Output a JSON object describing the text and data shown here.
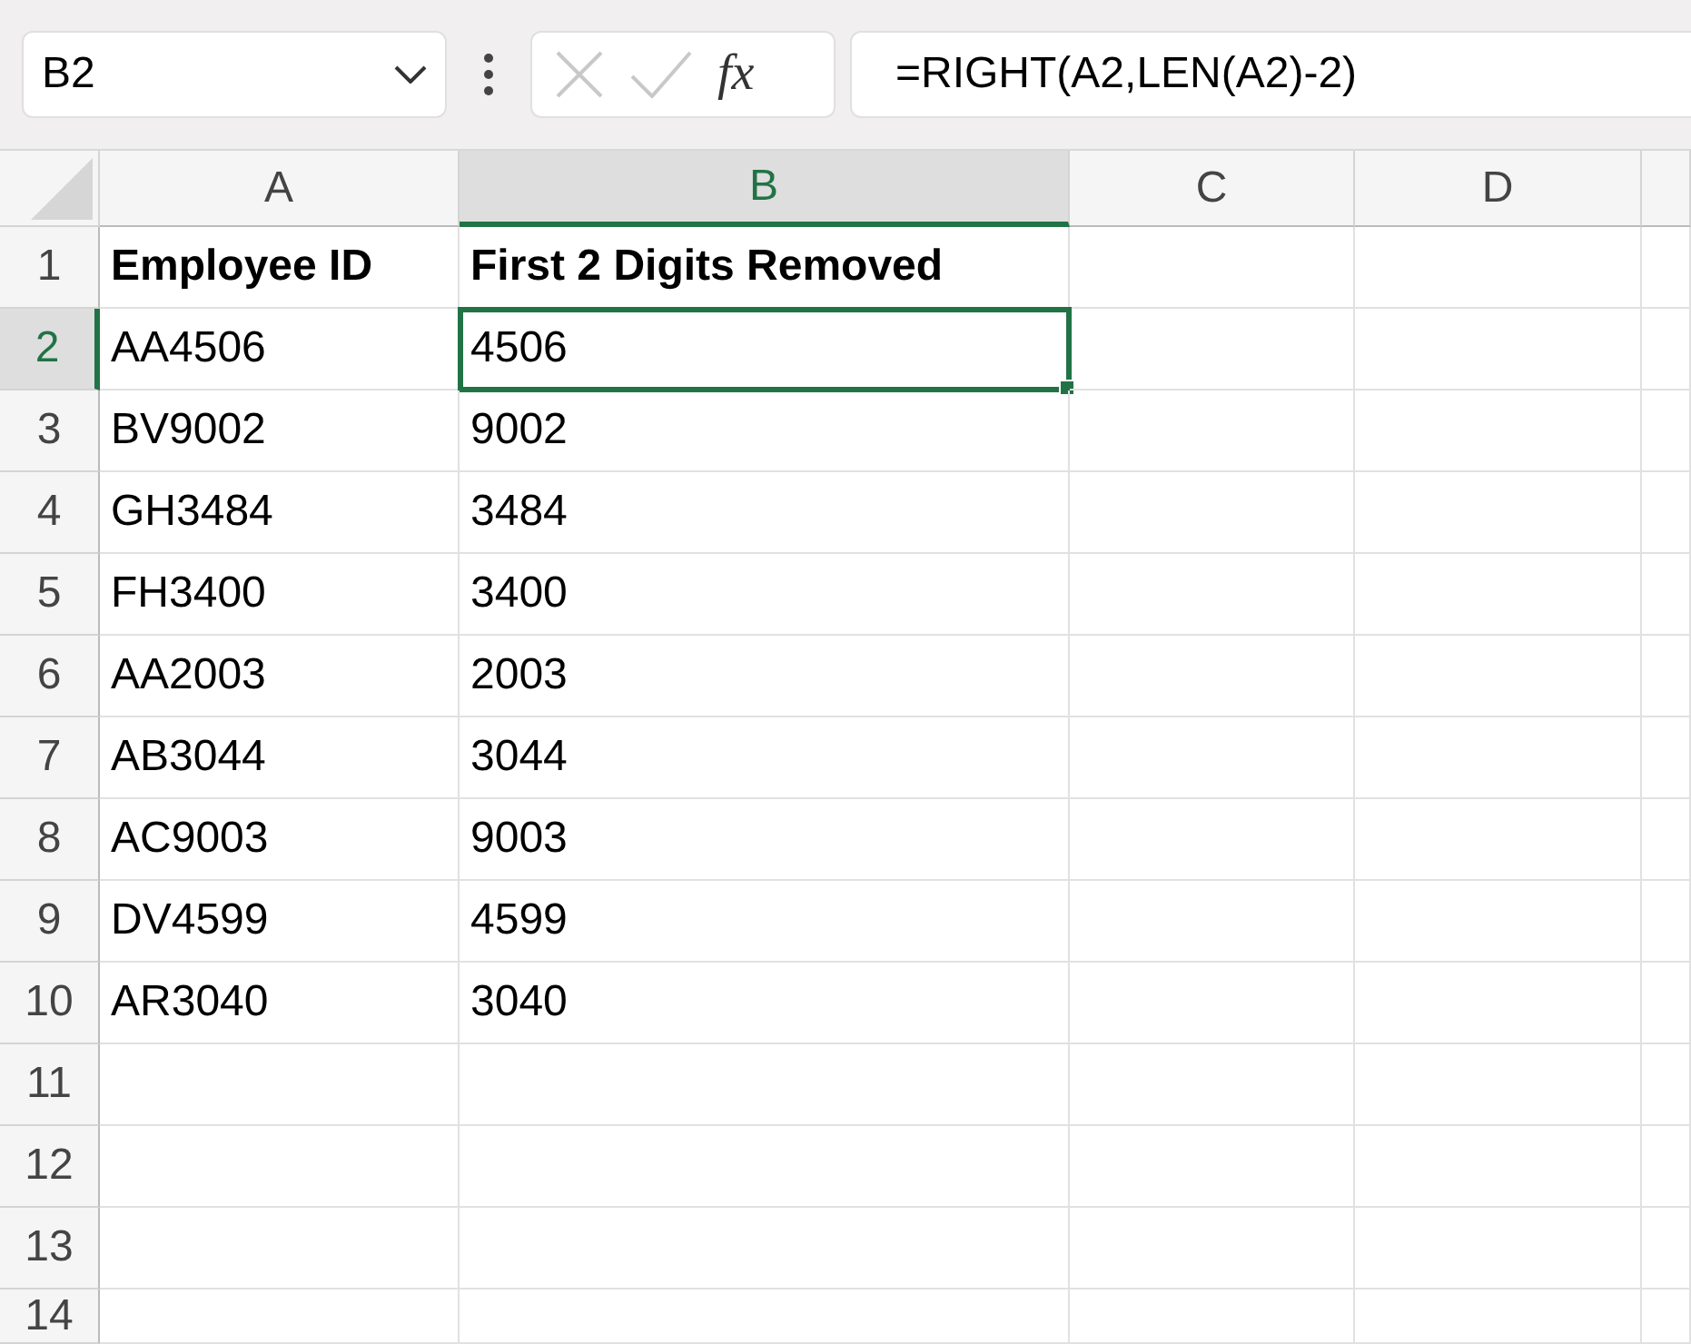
{
  "name_box": {
    "value": "B2"
  },
  "formula_bar": {
    "fx_label": "fx",
    "formula": "=RIGHT(A2,LEN(A2)-2)"
  },
  "columns": [
    {
      "label": "A",
      "selected": false
    },
    {
      "label": "B",
      "selected": true
    },
    {
      "label": "C",
      "selected": false
    },
    {
      "label": "D",
      "selected": false
    }
  ],
  "rows": [
    {
      "label": "1",
      "selected": false,
      "bold": true,
      "cells": [
        "Employee ID",
        "First 2 Digits Removed"
      ]
    },
    {
      "label": "2",
      "selected": true,
      "bold": false,
      "cells": [
        "AA4506",
        "4506"
      ]
    },
    {
      "label": "3",
      "selected": false,
      "bold": false,
      "cells": [
        "BV9002",
        "9002"
      ]
    },
    {
      "label": "4",
      "selected": false,
      "bold": false,
      "cells": [
        "GH3484",
        "3484"
      ]
    },
    {
      "label": "5",
      "selected": false,
      "bold": false,
      "cells": [
        "FH3400",
        "3400"
      ]
    },
    {
      "label": "6",
      "selected": false,
      "bold": false,
      "cells": [
        "AA2003",
        "2003"
      ]
    },
    {
      "label": "7",
      "selected": false,
      "bold": false,
      "cells": [
        "AB3044",
        "3044"
      ]
    },
    {
      "label": "8",
      "selected": false,
      "bold": false,
      "cells": [
        "AC9003",
        "9003"
      ]
    },
    {
      "label": "9",
      "selected": false,
      "bold": false,
      "cells": [
        "DV4599",
        "4599"
      ]
    },
    {
      "label": "10",
      "selected": false,
      "bold": false,
      "cells": [
        "AR3040",
        "3040"
      ]
    },
    {
      "label": "11",
      "selected": false
    },
    {
      "label": "12",
      "selected": false
    },
    {
      "label": "13",
      "selected": false
    },
    {
      "label": "14",
      "selected": false
    }
  ]
}
